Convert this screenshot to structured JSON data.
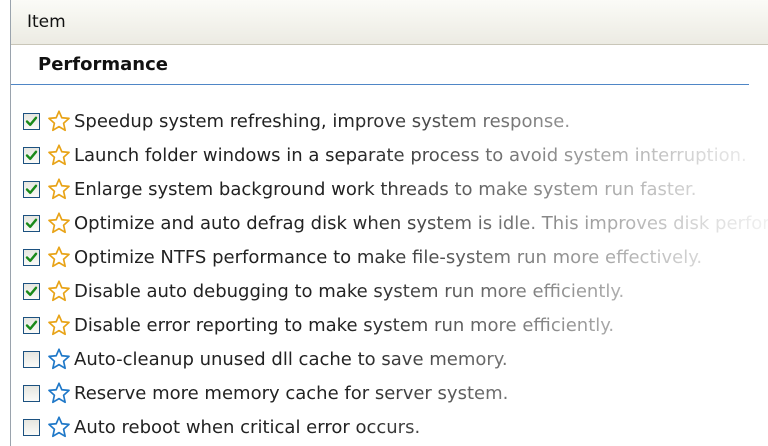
{
  "header": {
    "column_title": "Item"
  },
  "section": {
    "title": "Performance"
  },
  "colors": {
    "star_checked": "#e8a317",
    "star_unchecked": "#1f78c8",
    "check": "#1a8a1a"
  },
  "items": [
    {
      "label": "Speedup system refreshing, improve system response.",
      "checked": true
    },
    {
      "label": "Launch folder windows in a separate process to avoid system interruption.",
      "checked": true
    },
    {
      "label": "Enlarge system background work threads to make system run faster.",
      "checked": true
    },
    {
      "label": "Optimize and auto defrag disk when system is idle. This improves disk performance.",
      "checked": true
    },
    {
      "label": "Optimize NTFS performance to make file-system run more effectively.",
      "checked": true
    },
    {
      "label": "Disable auto debugging to make system run more efficiently.",
      "checked": true
    },
    {
      "label": "Disable error reporting to make system run more efficiently.",
      "checked": true
    },
    {
      "label": "Auto-cleanup unused dll cache to save memory.",
      "checked": false
    },
    {
      "label": "Reserve more memory cache for server system.",
      "checked": false
    },
    {
      "label": "Auto reboot when critical error occurs.",
      "checked": false
    }
  ]
}
